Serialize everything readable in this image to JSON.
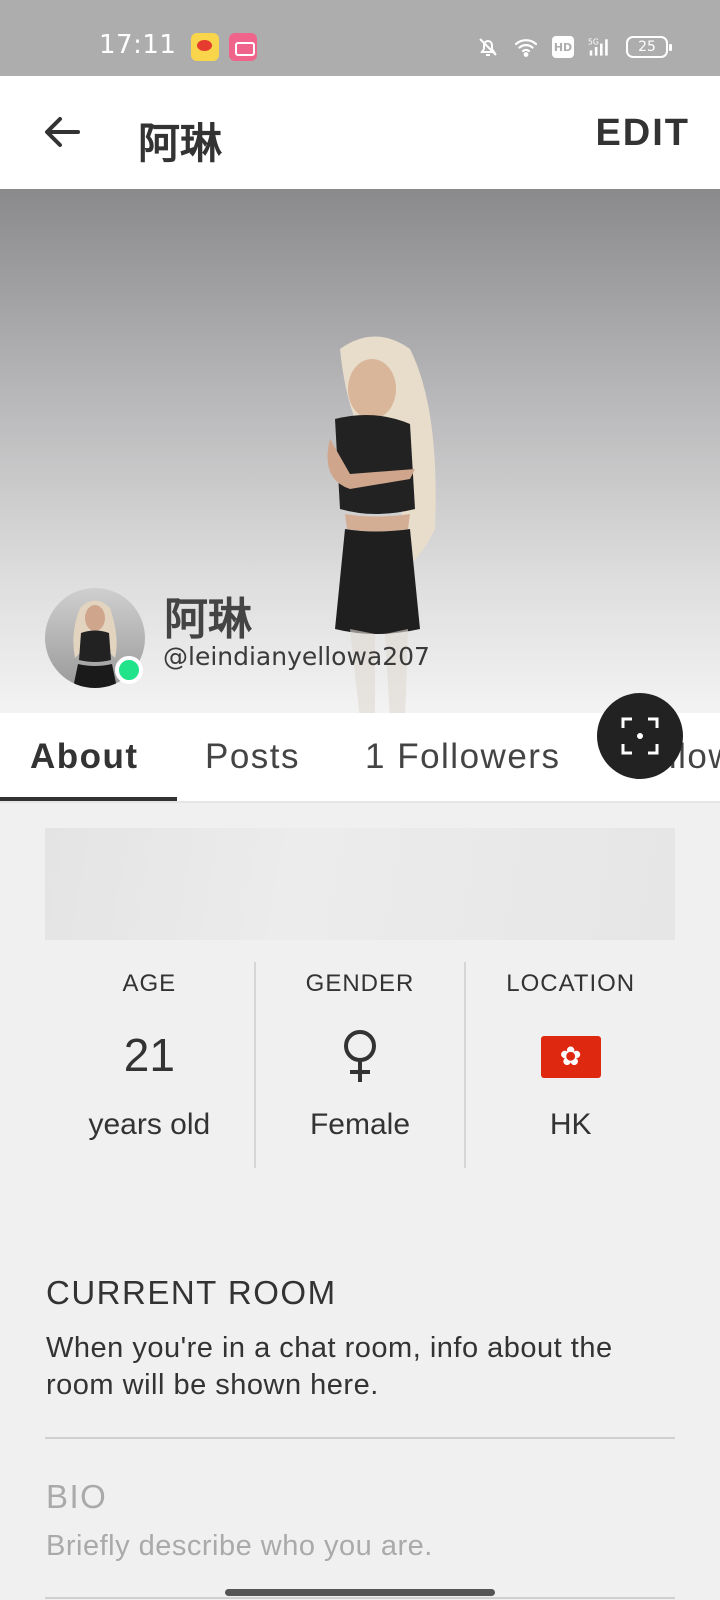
{
  "status_bar": {
    "time": "17:11",
    "battery": "25",
    "network": "5G",
    "hd": "HD",
    "icons": [
      "weibo-app-icon",
      "bilibili-app-icon",
      "bell-off-icon",
      "wifi-icon",
      "hd-icon",
      "signal-icon",
      "battery-icon"
    ]
  },
  "app_bar": {
    "title": "阿琳",
    "edit_label": "EDIT",
    "back_icon": "arrow-left-icon"
  },
  "profile": {
    "display_name": "阿琳",
    "username": "@leindianyellowa207",
    "online": true,
    "online_color": "#21e38a"
  },
  "tabs": [
    {
      "label": "About",
      "active": true
    },
    {
      "label": "Posts",
      "active": false
    },
    {
      "label": "1 Followers",
      "active": false
    },
    {
      "label": "Following",
      "active": false
    }
  ],
  "stats": {
    "age": {
      "label": "AGE",
      "value": "21",
      "sub": "years old"
    },
    "gender": {
      "label": "GENDER",
      "icon": "female-symbol-icon",
      "sub": "Female"
    },
    "location": {
      "label": "LOCATION",
      "icon": "hong-kong-flag-icon",
      "sub": "HK"
    }
  },
  "current_room": {
    "title": "CURRENT ROOM",
    "text": "When you're in a chat room, info about the room will be shown here."
  },
  "bio": {
    "title": "BIO",
    "placeholder": "Briefly describe who you are."
  }
}
